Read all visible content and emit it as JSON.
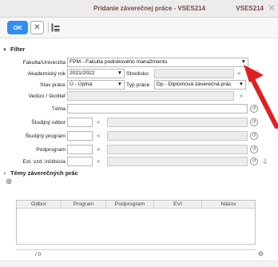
{
  "window": {
    "title": "Pridanie záverečnej práce - VSES214",
    "code": "VSES214",
    "close_glyph": "✕"
  },
  "toolbar": {
    "ok_label": "OK",
    "cancel_glyph": "✕"
  },
  "filter": {
    "title": "Filter",
    "fakulta": {
      "label": "Fakulta/Univerzita",
      "value": "FPM - Fakulta podnikového manažmentu"
    },
    "akad_rok": {
      "label": "Akademický rok",
      "value": "2021/2022"
    },
    "stredisko": {
      "label": "Stredisko",
      "value": ""
    },
    "stav_prace": {
      "label": "Stav práce",
      "value": "Ú - Úplná"
    },
    "typ_prace": {
      "label": "Typ práce",
      "value": "Dp - Diplomová záverečná prác"
    },
    "veduci": {
      "label": "Vedúci / školiteľ",
      "value": ""
    },
    "tema": {
      "label": "Téma",
      "value": ""
    },
    "studijny_odbor": {
      "label": "Študijný odbor",
      "value": ""
    },
    "studijny_program": {
      "label": "Študijný program",
      "value": ""
    },
    "podprogram": {
      "label": "Podprogram",
      "value": ""
    },
    "ext_institucia": {
      "label": "Ext. vzd. inštitúcia",
      "value": ""
    }
  },
  "temy": {
    "title": "Témy záverečných prác",
    "columns": [
      "Odbor",
      "Program",
      "Podprogram",
      "EVI",
      "Názov"
    ],
    "rows": []
  },
  "pager": {
    "text": "/ 0"
  },
  "colors": {
    "accent": "#2e8ff5",
    "annotation": "#e02020",
    "title_text": "#7a4848"
  }
}
